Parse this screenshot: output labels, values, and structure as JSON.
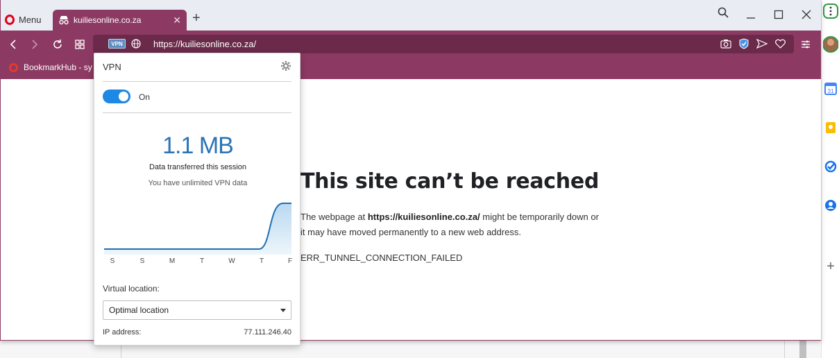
{
  "browser": {
    "menu_label": "Menu",
    "tab_title": "kuiliesonline.co.za",
    "url": "https://kuiliesonline.co.za/",
    "vpn_badge": "VPN",
    "bookmark": "BookmarkHub - sy"
  },
  "error_page": {
    "title": "This site can’t be reached",
    "body_prefix": "The webpage at ",
    "body_url": "https://kuiliesonline.co.za/",
    "body_suffix": " might be temporarily down or it may have moved permanently to a new web address.",
    "code": "ERR_TUNNEL_CONNECTION_FAILED"
  },
  "vpn_popup": {
    "title": "VPN",
    "toggle_state": "On",
    "data_amount": "1.1 MB",
    "data_label": "Data transferred this session",
    "data_note": "You have unlimited VPN data",
    "days": [
      "S",
      "S",
      "M",
      "T",
      "W",
      "T",
      "F"
    ],
    "usage": [
      0,
      0,
      0,
      0,
      0,
      0,
      1
    ],
    "location_label": "Virtual location:",
    "location_value": "Optimal location",
    "ip_label": "IP address:",
    "ip_value": "77.111.246.40"
  },
  "side_panel": {
    "calendar_day": "31"
  },
  "colors": {
    "opera_frame": "#8c3a63",
    "address_bar": "#6b2a4a",
    "vpn_accent": "#2a74b6",
    "toggle_on": "#1e88e5"
  }
}
